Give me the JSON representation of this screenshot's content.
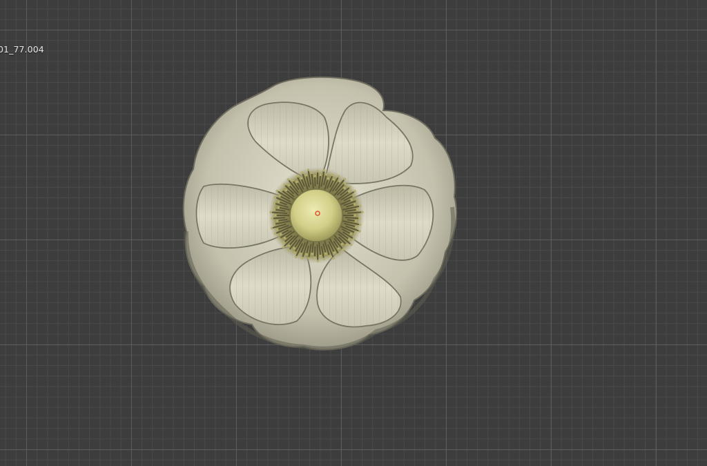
{
  "viewport": {
    "object_name": "01_77.004",
    "colors": {
      "background": "#3d3d3d",
      "grid_major": "#5f5f5f",
      "grid_minor": "#4b4b4b",
      "petal": "#cfccba",
      "petal_shadow": "#6b6a5a",
      "stamen": "#8f8a58",
      "center": "#d4d08a",
      "origin_marker": "#e0502a"
    },
    "icons": [
      "object-origin-icon"
    ]
  }
}
